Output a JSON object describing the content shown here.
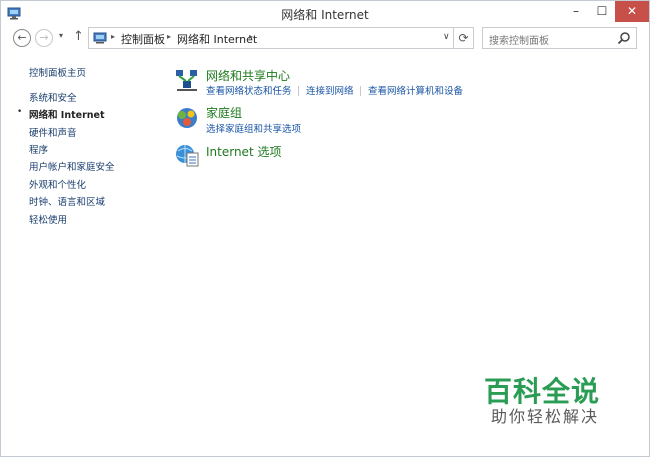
{
  "window": {
    "title": "网络和 Internet",
    "minimize_label": "–",
    "maximize_label": "☐",
    "close_label": "✕"
  },
  "navbar": {
    "back_label": "←",
    "forward_label": "→",
    "recent_label": "▾",
    "up_label": "↑",
    "breadcrumbs": [
      "控制面板",
      "网络和 Internet"
    ],
    "separator": "▸",
    "dropdown_label": "∨",
    "refresh_label": "⟳",
    "search_placeholder": "搜索控制面板"
  },
  "sidebar": {
    "items": [
      {
        "label": "控制面板主页"
      },
      {
        "label": "系统和安全"
      },
      {
        "label": "网络和 Internet",
        "current": true
      },
      {
        "label": "硬件和声音"
      },
      {
        "label": "程序"
      },
      {
        "label": "用户帐户和家庭安全"
      },
      {
        "label": "外观和个性化"
      },
      {
        "label": "时钟、语言和区域"
      },
      {
        "label": "轻松使用"
      }
    ],
    "bullet": "•"
  },
  "categories": [
    {
      "title": "网络和共享中心",
      "icon": "network-sharing-center-icon",
      "links": [
        "查看网络状态和任务",
        "连接到网络",
        "查看网络计算机和设备"
      ]
    },
    {
      "title": "家庭组",
      "icon": "homegroup-icon",
      "links": [
        "选择家庭组和共享选项"
      ]
    },
    {
      "title": "Internet 选项",
      "icon": "internet-options-icon",
      "links": []
    }
  ],
  "watermark": {
    "title": "百科全说",
    "subtitle": "助你轻松解决"
  },
  "colors": {
    "category_title": "#1e7a1e",
    "link": "#1a55a5",
    "sidebar_link": "#1a3e6e",
    "close_button": "#c7504a",
    "watermark": "#2b9c54"
  }
}
